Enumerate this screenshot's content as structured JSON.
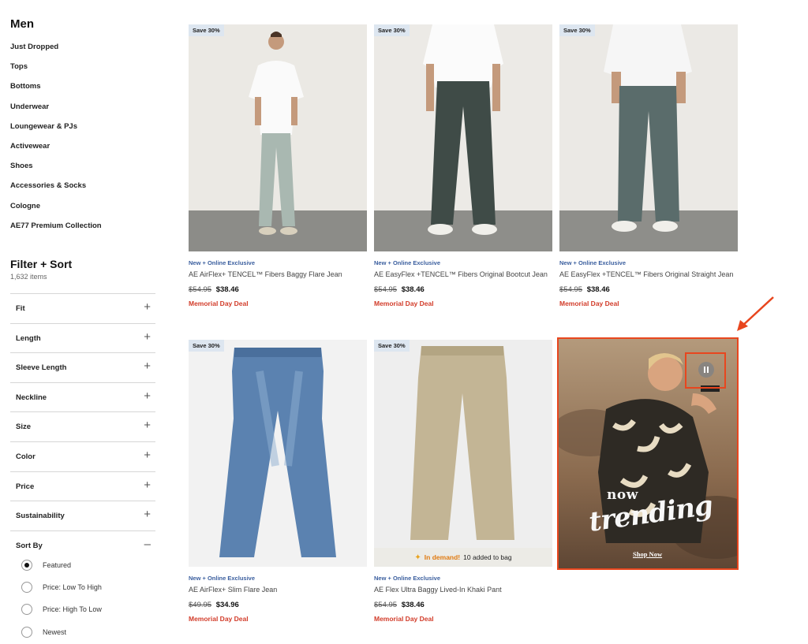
{
  "sidebar": {
    "title": "Men",
    "categories": [
      "Just Dropped",
      "Tops",
      "Bottoms",
      "Underwear",
      "Loungewear & PJs",
      "Activewear",
      "Shoes",
      "Accessories & Socks",
      "Cologne",
      "AE77 Premium Collection"
    ],
    "filter_title": "Filter + Sort",
    "item_count": "1,632 items",
    "filters": [
      {
        "label": "Fit",
        "icon": "+"
      },
      {
        "label": "Length",
        "icon": "+"
      },
      {
        "label": "Sleeve Length",
        "icon": "+"
      },
      {
        "label": "Neckline",
        "icon": "+"
      },
      {
        "label": "Size",
        "icon": "+"
      },
      {
        "label": "Color",
        "icon": "+"
      },
      {
        "label": "Price",
        "icon": "+"
      },
      {
        "label": "Sustainability",
        "icon": "+"
      },
      {
        "label": "Sort By",
        "icon": "–"
      }
    ],
    "sort_options": [
      {
        "label": "Featured",
        "selected": true
      },
      {
        "label": "Price: Low To High",
        "selected": false
      },
      {
        "label": "Price: High To Low",
        "selected": false
      },
      {
        "label": "Newest",
        "selected": false
      }
    ]
  },
  "products": [
    {
      "badge": "Save 30%",
      "tag": "New + Online Exclusive",
      "name": "AE AirFlex+ TENCEL™ Fibers Baggy Flare Jean",
      "old_price": "$54.95",
      "price": "$38.46",
      "deal": "Memorial Day Deal"
    },
    {
      "badge": "Save 30%",
      "tag": "New + Online Exclusive",
      "name": "AE EasyFlex +TENCEL™ Fibers Original Bootcut Jean",
      "old_price": "$54.95",
      "price": "$38.46",
      "deal": "Memorial Day Deal"
    },
    {
      "badge": "Save 30%",
      "tag": "New + Online Exclusive",
      "name": "AE EasyFlex +TENCEL™ Fibers Original Straight Jean",
      "old_price": "$54.95",
      "price": "$38.46",
      "deal": "Memorial Day Deal"
    },
    {
      "badge": "Save 30%",
      "tag": "New + Online Exclusive",
      "name": "AE AirFlex+ Slim Flare Jean",
      "old_price": "$49.95",
      "price": "$34.96",
      "deal": "Memorial Day Deal"
    },
    {
      "badge": "Save 30%",
      "tag": "New + Online Exclusive",
      "name": "AE Flex Ultra Baggy Lived-In Khaki Pant",
      "old_price": "$54.95",
      "price": "$38.46",
      "deal": "Memorial Day Deal",
      "demand_hot": "In demand!",
      "demand_text": "10 added to bag"
    }
  ],
  "promo": {
    "line1": "now",
    "line2": "trending",
    "cta": "Shop Now"
  },
  "colors": {
    "accent_orange": "#e8461e",
    "deal_red": "#d23c2a",
    "tag_blue": "#3a5e9e",
    "badge_bg": "#dde6f0"
  }
}
